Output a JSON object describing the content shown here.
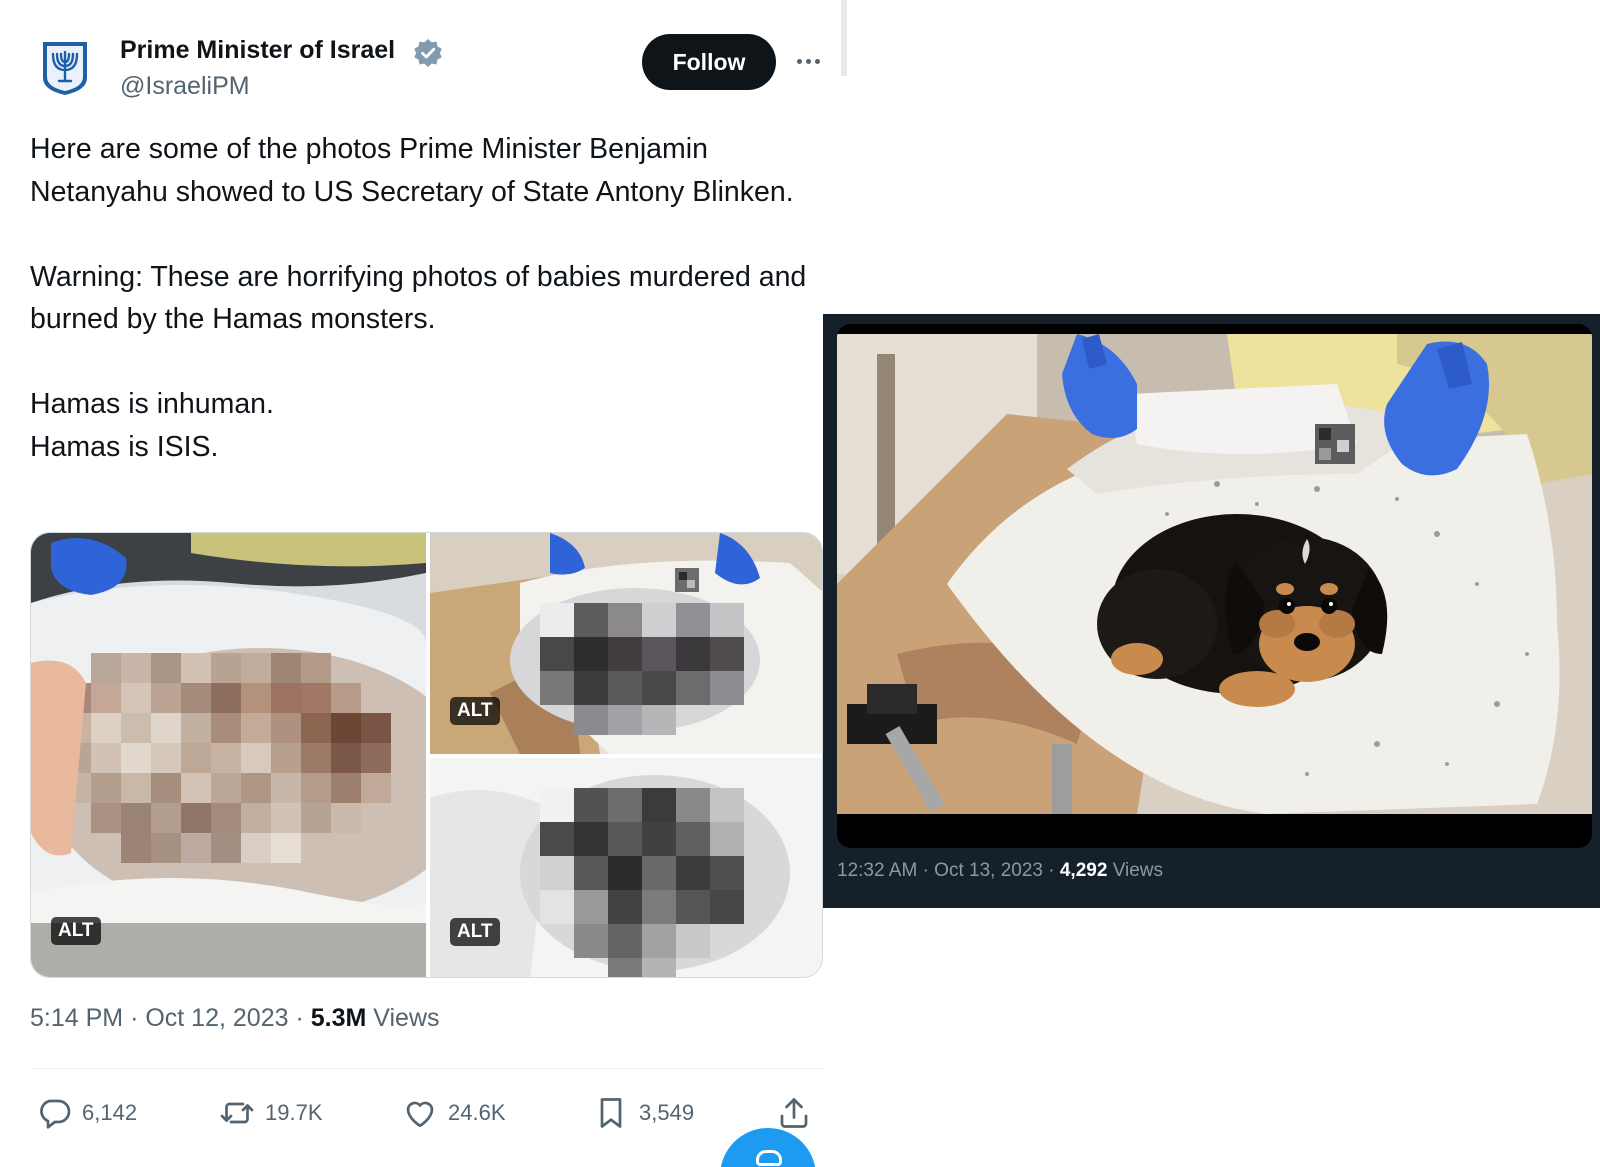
{
  "tweet": {
    "author": {
      "name": "Prime Minister of Israel",
      "handle": "@IsraeliPM",
      "verified": true,
      "avatar_icon": "menorah-emblem-icon"
    },
    "follow_label": "Follow",
    "more_icon": "more-horizontal-icon",
    "body": {
      "p1": "Here are some of the photos Prime Minister Benjamin Netanyahu showed to US Secretary of State Antony Blinken.",
      "p2": "Warning: These are horrifying photos of babies murdered and burned by the Hamas monsters.",
      "p3a": "Hamas is inhuman.",
      "p3b": "Hamas is ISIS."
    },
    "media": [
      {
        "alt_label": "ALT"
      },
      {
        "alt_label": "ALT"
      },
      {
        "alt_label": "ALT"
      }
    ],
    "meta": {
      "time": "5:14 PM",
      "sep1": "·",
      "date": "Oct 12, 2023",
      "sep2": "·",
      "views_count": "5.3M",
      "views_label": "Views"
    },
    "actions": {
      "replies": "6,142",
      "reposts": "19.7K",
      "likes": "24.6K",
      "bookmarks": "3,549"
    }
  },
  "second_post": {
    "meta": {
      "time": "12:32 AM",
      "sep1": "·",
      "date": "Oct 13, 2023",
      "sep2": "·",
      "views_count": "4,292",
      "views_label": "Views"
    }
  },
  "colors": {
    "accent": "#1d9bf0",
    "text_primary": "#0f1419",
    "text_secondary": "#536471",
    "dark_bg": "#15202b",
    "verified_badge": "#829aab"
  }
}
